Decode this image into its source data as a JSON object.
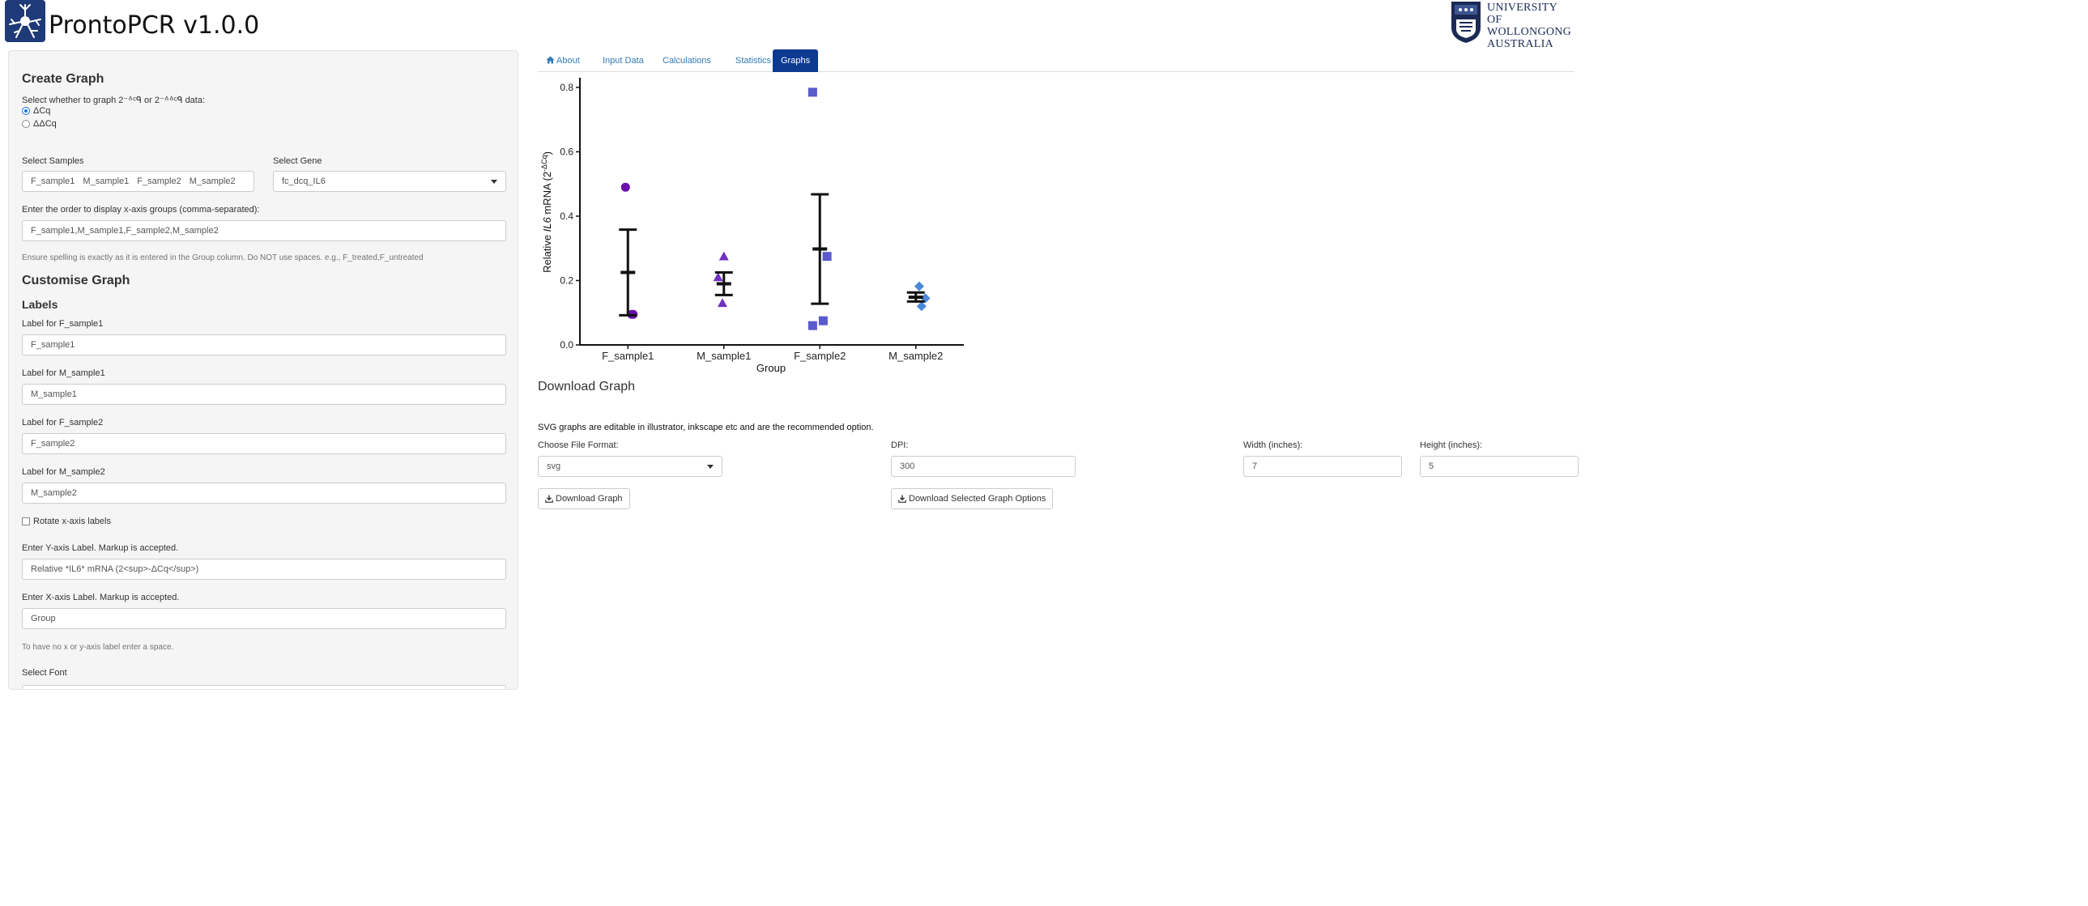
{
  "header": {
    "title": "ProntoPCR v1.0.0",
    "logo_icon": "neuron-logo-icon",
    "university_lines": [
      "UNIVERSITY",
      "OF WOLLONGONG",
      "AUSTRALIA"
    ]
  },
  "sidebar": {
    "create_graph_heading": "Create Graph",
    "graph_type_prompt": "Select whether to graph 2⁻ᐞᶜᑫ or 2⁻ᐞᐞᶜᑫ data:",
    "graph_type_options": [
      {
        "label": "ΔCq",
        "checked": true
      },
      {
        "label": "ΔΔCq",
        "checked": false
      }
    ],
    "select_samples_label": "Select Samples",
    "selected_samples": [
      "F_sample1",
      "M_sample1",
      "F_sample2",
      "M_sample2"
    ],
    "select_gene_label": "Select Gene",
    "selected_gene": "fc_dcq_IL6",
    "order_label": "Enter the order to display x-axis groups (comma-separated):",
    "order_value": "F_sample1,M_sample1,F_sample2,M_sample2",
    "order_help": "Ensure spelling is exactly as it is entered in the Group column. Do NOT use spaces. e.g., F_treated,F_untreated",
    "customise_heading": "Customise Graph",
    "labels_heading": "Labels",
    "label_fields": [
      {
        "label": "Label for F_sample1",
        "value": "F_sample1"
      },
      {
        "label": "Label for M_sample1",
        "value": "M_sample1"
      },
      {
        "label": "Label for F_sample2",
        "value": "F_sample2"
      },
      {
        "label": "Label for M_sample2",
        "value": "M_sample2"
      }
    ],
    "rotate_label": "Rotate x-axis labels",
    "rotate_checked": false,
    "y_label_prompt": "Enter Y-axis Label. Markup is accepted.",
    "y_label_value": "Relative *IL6* mRNA (2<sup>-ΔCq</sup>)",
    "x_label_prompt": "Enter X-axis Label. Markup is accepted.",
    "x_label_value": "Group",
    "axis_label_help": "To have no x or y-axis label enter a space.",
    "select_font_label": "Select Font"
  },
  "tabs": [
    {
      "label": "About",
      "icon": "home-icon",
      "active": false
    },
    {
      "label": "Input Data",
      "active": false
    },
    {
      "label": "Calculations",
      "active": false
    },
    {
      "label": "Statistics",
      "active": false
    },
    {
      "label": "Graphs",
      "active": true
    }
  ],
  "chart_data": {
    "type": "scatter",
    "title": "",
    "xlabel": "Group",
    "ylabel_prefix": "Relative ",
    "ylabel_gene": "IL6",
    "ylabel_suffix": " mRNA (2",
    "ylabel_sup": "-ΔCq",
    "ylabel_end": ")",
    "ylim": [
      0,
      0.82
    ],
    "yticks": [
      0.0,
      0.2,
      0.4,
      0.6,
      0.8
    ],
    "ytick_labels": [
      "0.0",
      "0.2",
      "0.4",
      "0.6",
      "0.8"
    ],
    "categories": [
      "F_sample1",
      "M_sample1",
      "F_sample2",
      "M_sample2"
    ],
    "series": [
      {
        "category": "F_sample1",
        "shape": "circle",
        "color": "#6a0dad",
        "points": [
          {
            "dx": -0.05,
            "y": 0.49
          },
          {
            "dx": 0.08,
            "y": 0.095
          },
          {
            "dx": 0.11,
            "y": 0.095
          }
        ],
        "mean": 0.225,
        "err_low": 0.092,
        "err_high": 0.358
      },
      {
        "category": "M_sample1",
        "shape": "triangle",
        "color": "#7030c0",
        "points": [
          {
            "dx": 0.0,
            "y": 0.275
          },
          {
            "dx": -0.12,
            "y": 0.21
          },
          {
            "dx": -0.03,
            "y": 0.13
          }
        ],
        "mean": 0.19,
        "err_low": 0.155,
        "err_high": 0.225
      },
      {
        "category": "F_sample2",
        "shape": "square",
        "color": "#5a5acd",
        "points": [
          {
            "dx": -0.15,
            "y": 0.785
          },
          {
            "dx": 0.15,
            "y": 0.275
          },
          {
            "dx": 0.07,
            "y": 0.075
          },
          {
            "dx": -0.15,
            "y": 0.06
          }
        ],
        "mean": 0.298,
        "err_low": 0.128,
        "err_high": 0.468
      },
      {
        "category": "M_sample2",
        "shape": "diamond",
        "color": "#4a88d8",
        "points": [
          {
            "dx": 0.07,
            "y": 0.182
          },
          {
            "dx": 0.2,
            "y": 0.145
          },
          {
            "dx": 0.12,
            "y": 0.12
          }
        ],
        "mean": 0.148,
        "err_low": 0.135,
        "err_high": 0.163
      }
    ]
  },
  "download": {
    "heading": "Download Graph",
    "note": "SVG graphs are editable in illustrator, inkscape etc and are the recommended option.",
    "format_label": "Choose File Format:",
    "format_value": "svg",
    "dpi_label": "DPI:",
    "dpi_value": "300",
    "width_label": "Width (inches):",
    "width_value": "7",
    "height_label": "Height (inches):",
    "height_value": "5",
    "download_graph_label": "Download Graph",
    "download_options_label": "Download Selected Graph Options"
  }
}
